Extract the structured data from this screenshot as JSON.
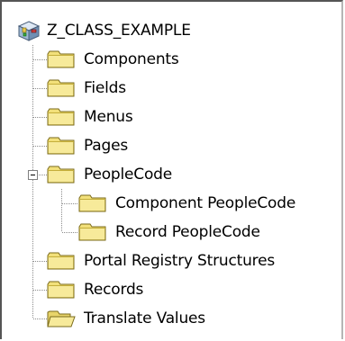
{
  "tree": {
    "root": {
      "label": "Z_CLASS_EXAMPLE",
      "icon": "project-cube-icon"
    },
    "items": [
      {
        "label": "Components",
        "icon": "folder-closed-icon"
      },
      {
        "label": "Fields",
        "icon": "folder-closed-icon"
      },
      {
        "label": "Menus",
        "icon": "folder-closed-icon"
      },
      {
        "label": "Pages",
        "icon": "folder-closed-icon"
      },
      {
        "label": "PeopleCode",
        "icon": "folder-closed-icon",
        "expanded": true,
        "children": [
          {
            "label": "Component PeopleCode",
            "icon": "folder-closed-icon"
          },
          {
            "label": "Record PeopleCode",
            "icon": "folder-closed-icon"
          }
        ]
      },
      {
        "label": "Portal Registry Structures",
        "icon": "folder-closed-icon"
      },
      {
        "label": "Records",
        "icon": "folder-closed-icon"
      },
      {
        "label": "Translate Values",
        "icon": "folder-open-icon"
      }
    ],
    "colors": {
      "folder_fill": "#f2e07a",
      "folder_edge": "#7a6a1a",
      "connector": "#8c8c8c"
    }
  }
}
